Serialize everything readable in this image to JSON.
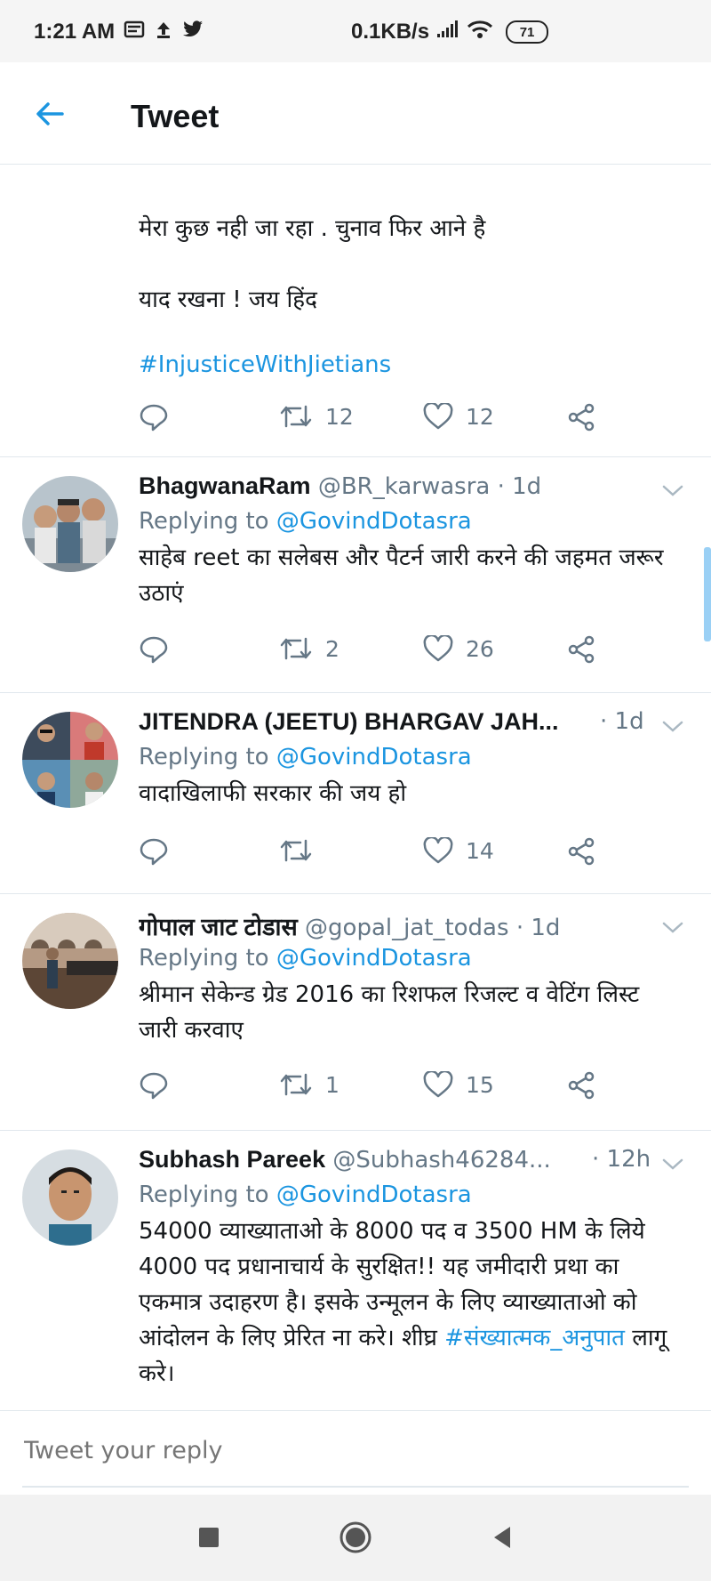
{
  "status_bar": {
    "time": "1:21 AM",
    "left_icons": [
      "message-icon",
      "upload-icon",
      "twitter-icon"
    ],
    "net_speed": "0.1KB/s",
    "battery": "71"
  },
  "appbar": {
    "title": "Tweet",
    "back_icon": "arrow-left-icon"
  },
  "first_tweet": {
    "line1": "मेरा कुछ नही जा रहा . चुनाव फिर आने है",
    "line2": "याद रखना ! जय हिंद",
    "hashtag": "#InjusticeWithJietians",
    "retweets": "12",
    "likes": "12"
  },
  "replying_label": "Replying to",
  "replies": [
    {
      "name": "BhagwanaRam",
      "handle": "@BR_karwasra",
      "time": "· 1d",
      "mention": "@GovindDotasra",
      "text": "साहेब reet का सलेबस और पैटर्न जारी करने की जहमत जरूर उठाएं",
      "retweets": "2",
      "likes": "26"
    },
    {
      "name": "JITENDRA (JEETU) BHARGAV JAH...",
      "handle": "",
      "time": "· 1d",
      "mention": "@GovindDotasra",
      "text": "वादाखिलाफी सरकार की जय हो",
      "retweets": "",
      "likes": "14"
    },
    {
      "name": "गोपाल जाट टोडास",
      "handle": "@gopal_jat_todas",
      "time": "· 1d",
      "mention": "@GovindDotasra",
      "text": "श्रीमान सेकेन्ड ग्रेड 2016 का रिशफल रिजल्ट व वेटिंग लिस्ट जारी करवाए",
      "retweets": "1",
      "likes": "15"
    },
    {
      "name": "Subhash Pareek",
      "handle": "@Subhash46284...",
      "time": "· 12h",
      "mention": "@GovindDotasra",
      "text": "54000 व्याख्याताओ के 8000 पद व 3500 HM के लिये 4000 पद प्रधानाचार्य के सुरक्षित!! यह जमीदारी प्रथा का एकमात्र उदाहरण है। इसके उन्मूलन के लिए व्याख्याताओ को आंदोलन के लिए प्रेरित ना करे। शीघ्र",
      "hashtag": "#संख्यात्मक_अनुपात",
      "text_end": " लागू करे।"
    }
  ],
  "composer": {
    "placeholder": "Tweet your reply"
  },
  "colors": {
    "accent": "#1b95e0",
    "muted": "#657786",
    "text": "#14171a",
    "divider": "#e1e8ed"
  }
}
